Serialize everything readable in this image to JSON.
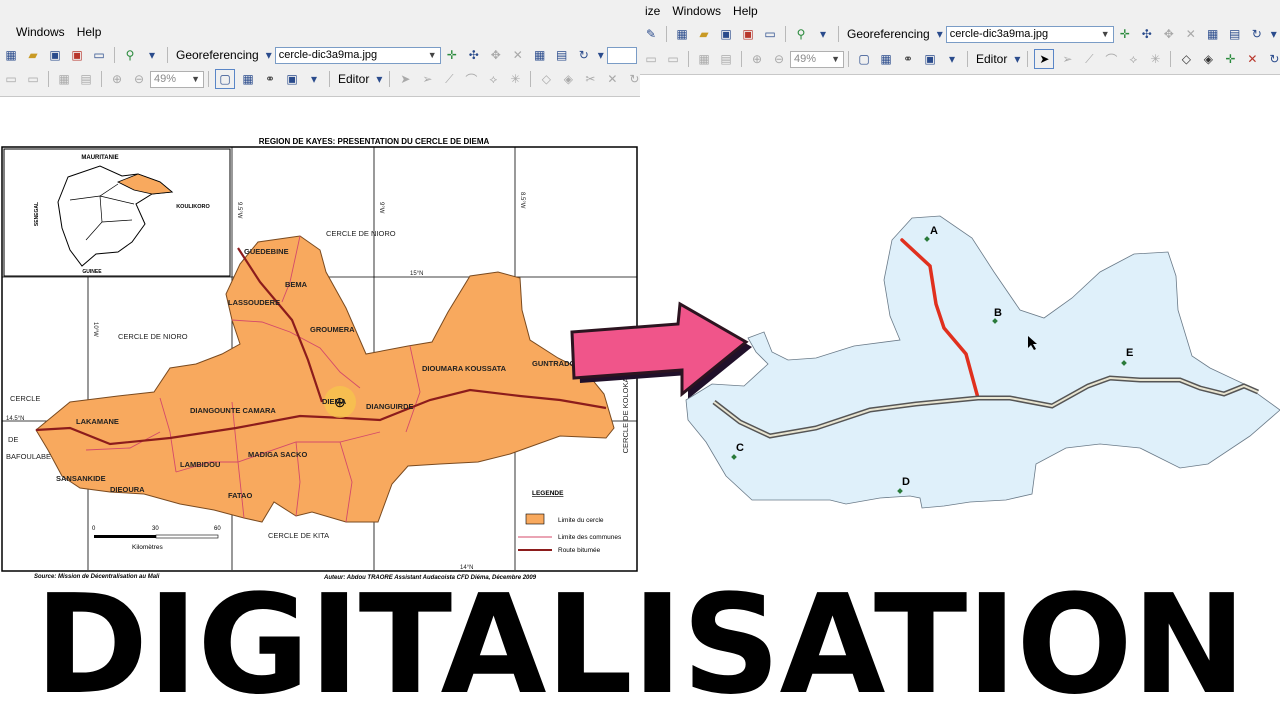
{
  "left_window": {
    "menu": [
      "Windows",
      "Help"
    ],
    "georef_label": "Georeferencing",
    "layer_combo": "cercle-dic3a9ma.jpg",
    "zoom_combo": "49%",
    "editor_label": "Editor"
  },
  "right_window": {
    "menu": [
      "ize",
      "Windows",
      "Help"
    ],
    "georef_label": "Georeferencing",
    "layer_combo": "cercle-dic3a9ma.jpg",
    "zoom_combo": "49%",
    "editor_label": "Editor"
  },
  "scanned_map": {
    "title": "REGION DE KAYES: PRESENTATION DU CERCLE DE DIEMA",
    "inset_labels": [
      "MAURITANIE",
      "SENEGAL",
      "KOULIKORO",
      "GUINEE"
    ],
    "place_labels": [
      "GUEDEBINE",
      "BEMA",
      "LASSOUDERE",
      "GROUMERA",
      "DIOUMARA KOUSSATA",
      "GUNTRADOUGOU",
      "DIEMA",
      "DIANGUIRDE",
      "DIANGOUNTE CAMARA",
      "LAKAMANE",
      "SANSANKIDE",
      "DIEOURA",
      "LAMBIDOU",
      "MADIGA SACKO",
      "FATAO",
      "CERCLE DE NIORO",
      "CERCLE DE NIORO",
      "CERCLE DE KITA",
      "CERCLE",
      "DE",
      "BAFOULABE",
      "CERCLE DE KOLOKANI"
    ],
    "grid_labels": [
      "10°W",
      "9.5°W",
      "9°W",
      "8.5°W",
      "15°N",
      "14.5°N",
      "14°N"
    ],
    "scale_labels": [
      "0",
      "30",
      "60",
      "Kilomètres"
    ],
    "legend_title": "LEGENDE",
    "legend_items": [
      "Limite du cercle",
      "Limite des communes",
      "Route bitumée"
    ],
    "source": "Source: Mission de Décentralisation au Mali",
    "author": "Auteur: Abdou TRAORE Assistant Audacoista CFD Diéma, Décembre 2009"
  },
  "digitized_map": {
    "point_labels": [
      "A",
      "B",
      "C",
      "D",
      "E"
    ]
  },
  "caption": "DIGITALISATION",
  "colors": {
    "toolbar": "#f0f0f0",
    "map_fill": "#f8a95e",
    "digitized_fill": "#dff0fa",
    "arrow": "#f0558a",
    "river": "#e0301e",
    "road": "#8c1c1c"
  }
}
